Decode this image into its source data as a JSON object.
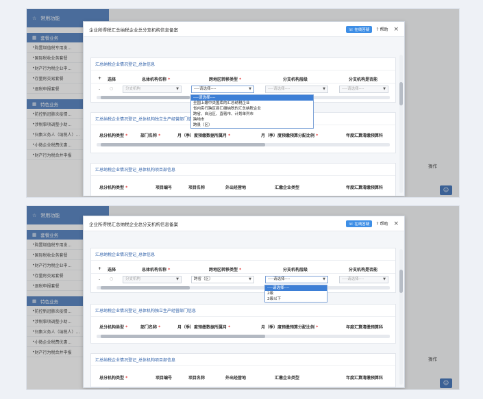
{
  "sidebar": {
    "common_label": "常用功能",
    "section_tax": "套餐业务",
    "items": [
      "购置增值税专用发…",
      "国际税收业务套餐",
      "财产行为税企业申…",
      "存量房交易套餐",
      "退税申报套餐"
    ],
    "section_feature": "特色业务",
    "feature_items": [
      "防控新冠肺炎疫情…",
      "涉税事项调整小助…",
      "归集义务人（纳税人）…",
      "小微企业税费优惠…",
      "财产行为税合并申报"
    ]
  },
  "background": {
    "op_label": "操作"
  },
  "modal": {
    "title": "企业所得税汇总纳税企业总分支机构信息备案",
    "online_button": "在线答疑",
    "help_button": "帮助",
    "close_glyph": "×"
  },
  "section1": {
    "title": "汇总纳税企业情况登记_总体信息",
    "headers": {
      "plus": "+",
      "select": "选择",
      "name": "总体机构名称",
      "region": "跨地区转移类型",
      "level": "分支机构层级",
      "flag": "分支机构是否能"
    },
    "req": "*",
    "row": {
      "minus": "-",
      "radio": "○",
      "name_value": "分支机构",
      "region_value_top": "----请选择----",
      "region_value_bottom": "跨省（区）",
      "level_value": "----请选择----",
      "flag_value": "----请选择----"
    }
  },
  "dropdown_region": {
    "options": [
      "----请选择----",
      "全国上缴中央国库的汇总纳税企业",
      "省内实行跨区县汇缴纳税的汇总纳税企业",
      "跨省、自治区、直辖市、计划单列市",
      "跨地市",
      "跨县（区）"
    ]
  },
  "dropdown_level": {
    "options": [
      "----请选择----",
      "2级",
      "2级以下"
    ]
  },
  "section2": {
    "title": "汇总纳税企业情况登记_总体机构独立生产经营部门信息",
    "headers": [
      "总分机构类型",
      "部门名称",
      "月（季）度预缴数据所属月",
      "月（季）度预缴预算分配比例",
      "年度汇算清缴预算科"
    ]
  },
  "section3": {
    "title": "汇总纳税企业情况登记_总体机构项目部信息",
    "headers": [
      "总分机构类型",
      "项目编号",
      "项目名称",
      "外出经营地",
      "汇缴企业类型",
      "年度汇算清缴预算科"
    ]
  },
  "colors": {
    "accent": "#3d7fd6",
    "title": "#2d5fa8",
    "required": "#e23c3c"
  }
}
